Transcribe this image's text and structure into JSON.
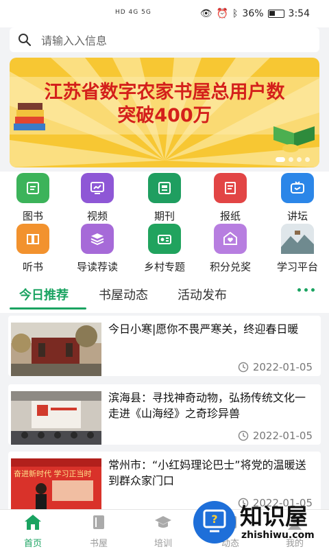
{
  "status_bar": {
    "signal": "HD 4G 5G",
    "battery": "36%",
    "time": "3:54"
  },
  "search": {
    "placeholder": "请输入入信息"
  },
  "banner": {
    "line1": "江苏省数字农家书屋总用户数",
    "line2": "突破400万"
  },
  "grid": [
    {
      "label": "图书",
      "icon": "book-icon",
      "color": "#3cb35a"
    },
    {
      "label": "视频",
      "icon": "video-icon",
      "color": "#8e57d6"
    },
    {
      "label": "期刊",
      "icon": "journal-icon",
      "color": "#1f9e60"
    },
    {
      "label": "报纸",
      "icon": "newspaper-icon",
      "color": "#e24545"
    },
    {
      "label": "讲坛",
      "icon": "tv-icon",
      "color": "#2b86e8"
    },
    {
      "label": "听书",
      "icon": "audiobook-icon",
      "color": "#f2922e"
    },
    {
      "label": "导读荐读",
      "icon": "stack-icon",
      "color": "#a66ad8"
    },
    {
      "label": "乡村专题",
      "icon": "radio-icon",
      "color": "#21a35e"
    },
    {
      "label": "积分兑奖",
      "icon": "heart-house-icon",
      "color": "#b77ee0"
    },
    {
      "label": "学习平台",
      "icon": "landscape-icon",
      "color": "#9aa7b0"
    }
  ],
  "tabs": [
    "今日推荐",
    "书屋动态",
    "活动发布"
  ],
  "news": [
    {
      "title": "今日小寒|愿你不畏严寒关，终迎春日暖",
      "date": "2022-01-05"
    },
    {
      "title": "滨海县：寻找神奇动物，弘扬传统文化一走进《山海经》之奇珍异兽",
      "date": "2022-01-05"
    },
    {
      "title": "常州市：“小红妈理论巴士”将党的温暖送到群众家门口",
      "date": "2022-01-05"
    }
  ],
  "thumb3": {
    "line1": "奋进新时代 学习正当时"
  },
  "nav": [
    "首页",
    "书屋",
    "培训",
    "动态",
    "我的"
  ],
  "watermark": {
    "brand": "知识屋",
    "site": "zhishiwu.com"
  }
}
